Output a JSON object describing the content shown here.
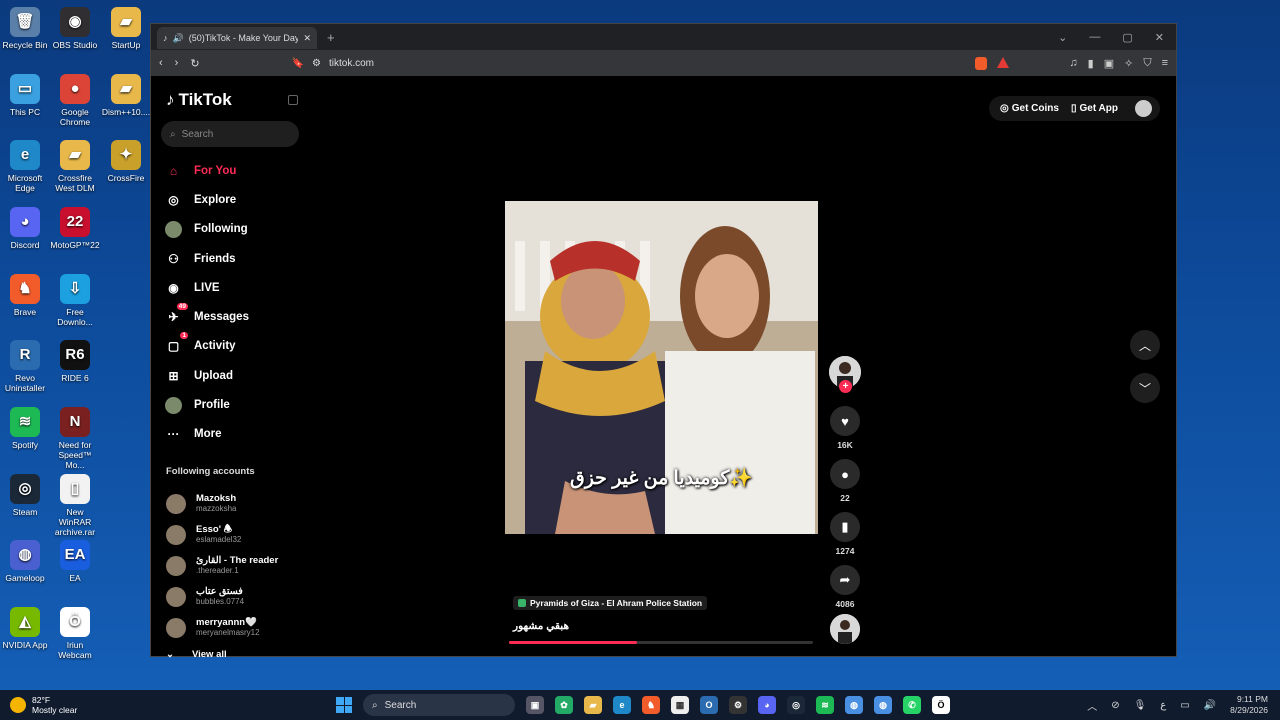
{
  "desktop": {
    "icons": [
      {
        "label": "Recycle Bin",
        "glyph": "🗑",
        "color": "#5a7fa8"
      },
      {
        "label": "OBS Studio",
        "glyph": "◉",
        "color": "#302e31"
      },
      {
        "label": "StartUp",
        "glyph": "▰",
        "color": "#e8b84a"
      },
      {
        "label": "This PC",
        "glyph": "▭",
        "color": "#3aa0e0"
      },
      {
        "label": "Google Chrome",
        "glyph": "●",
        "color": "#db4437"
      },
      {
        "label": "Dism++10....",
        "glyph": "▰",
        "color": "#e8b84a"
      },
      {
        "label": "Microsoft Edge",
        "glyph": "e",
        "color": "#1e88c8"
      },
      {
        "label": "Crossfire West DLM",
        "glyph": "▰",
        "color": "#e8b84a"
      },
      {
        "label": "CrossFire",
        "glyph": "✦",
        "color": "#c8a02a"
      },
      {
        "label": "Discord",
        "glyph": "◕",
        "color": "#5865f2"
      },
      {
        "label": "MotoGP™22",
        "glyph": "22",
        "color": "#c8102e"
      },
      {
        "label": "Brave",
        "glyph": "♞",
        "color": "#f25c2a"
      },
      {
        "label": "Free Downlo...",
        "glyph": "⇩",
        "color": "#1ca0e0"
      },
      {
        "label": "Revo Uninstaller",
        "glyph": "R",
        "color": "#2b6cb0"
      },
      {
        "label": "RIDE 6",
        "glyph": "R6",
        "color": "#111111"
      },
      {
        "label": "Spotify",
        "glyph": "≋",
        "color": "#1db954"
      },
      {
        "label": "Need for Speed™ Mo...",
        "glyph": "N",
        "color": "#7a2020"
      },
      {
        "label": "Steam",
        "glyph": "◎",
        "color": "#1b2838"
      },
      {
        "label": "New WinRAR archive.rar",
        "glyph": "▯",
        "color": "#f2f2f2"
      },
      {
        "label": "Gameloop",
        "glyph": "◍",
        "color": "#4a60d0"
      },
      {
        "label": "EA",
        "glyph": "EA",
        "color": "#1a5ee0"
      },
      {
        "label": "NVIDIA App",
        "glyph": "◭",
        "color": "#76b900"
      },
      {
        "label": "Iriun Webcam",
        "glyph": "Ö",
        "color": "#ffffff"
      }
    ]
  },
  "browser": {
    "tab_title": "(50)TikTok - Make Your Day",
    "url": "tiktok.com"
  },
  "tiktok": {
    "logo": "TikTok",
    "search_placeholder": "Search",
    "nav": [
      {
        "label": "For You",
        "icon": "home-icon",
        "glyph": "⌂",
        "active": true
      },
      {
        "label": "Explore",
        "icon": "compass-icon",
        "glyph": "◎"
      },
      {
        "label": "Following",
        "icon": "following-avatar-icon",
        "glyph": "●"
      },
      {
        "label": "Friends",
        "icon": "friends-icon",
        "glyph": "⚇"
      },
      {
        "label": "LIVE",
        "icon": "live-icon",
        "glyph": "◉"
      },
      {
        "label": "Messages",
        "icon": "messages-icon",
        "glyph": "✈",
        "badge": "49"
      },
      {
        "label": "Activity",
        "icon": "activity-icon",
        "glyph": "▢",
        "badge": "1"
      },
      {
        "label": "Upload",
        "icon": "upload-icon",
        "glyph": "⊞"
      },
      {
        "label": "Profile",
        "icon": "profile-avatar-icon",
        "glyph": "●"
      },
      {
        "label": "More",
        "icon": "more-icon",
        "glyph": "···"
      }
    ],
    "following_title": "Following accounts",
    "following": [
      {
        "name": "Mazoksh",
        "handle": "mazzoksha"
      },
      {
        "name": "Esso' 🕭",
        "handle": "eslamadel32"
      },
      {
        "name": "القارئ - The reader",
        "handle": ".thereader.1"
      },
      {
        "name": "فستق عتاب",
        "handle": "bubbles.0774"
      },
      {
        "name": "merryannn🤍",
        "handle": "meryanelmasry12"
      }
    ],
    "view_all": "View all",
    "get_coins": "Get Coins",
    "get_app": "Get App",
    "video": {
      "caption": "كوميديا من غير حزق✨",
      "location": "Pyramids of Giza - El Ahram Police Station",
      "description": "هبقي مشهور",
      "progress_percent": 42
    },
    "actions": {
      "likes": "16K",
      "comments": "22",
      "saves": "1274",
      "shares": "4086"
    }
  },
  "taskbar": {
    "temp": "82°F",
    "weather": "Mostly clear",
    "search": "Search",
    "time": "9:11 PM",
    "date": "8/29/2026",
    "lang": "ع"
  }
}
